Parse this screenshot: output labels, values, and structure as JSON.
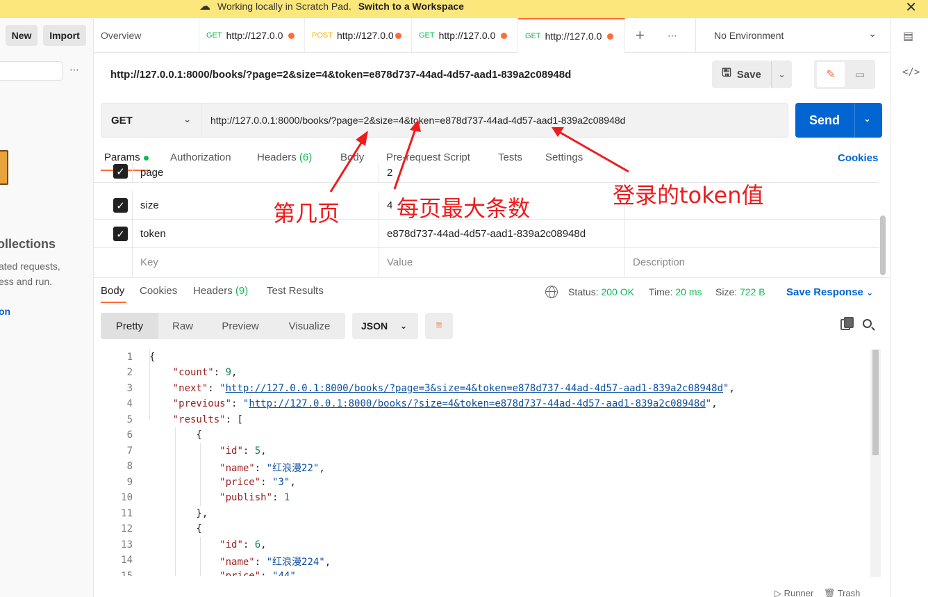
{
  "banner": {
    "message": "Working locally in Scratch Pad.",
    "link": "Switch to a Workspace"
  },
  "sidebar": {
    "new_label": "New",
    "import_label": "Import",
    "more": "⋯",
    "empty_heading": "ollections",
    "empty_text_1": "ated requests,",
    "empty_text_2": "ess and run.",
    "empty_link": "on"
  },
  "tabs": {
    "overview": "Overview",
    "items": [
      {
        "method": "GET",
        "label": "http://127.0.0"
      },
      {
        "method": "POST",
        "label": "http://127.0.0"
      },
      {
        "method": "GET",
        "label": "http://127.0.0"
      },
      {
        "method": "GET",
        "label": "http://127.0.0"
      }
    ],
    "plus": "+",
    "more": "⋯",
    "environment": "No Environment"
  },
  "request": {
    "title": "http://127.0.0.1:8000/books/?page=2&size=4&token=e878d737-44ad-4d57-aad1-839a2c08948d",
    "save_label": "Save",
    "method": "GET",
    "url": "http://127.0.0.1:8000/books/?page=2&size=4&token=e878d737-44ad-4d57-aad1-839a2c08948d",
    "send_label": "Send"
  },
  "request_tabs": {
    "params": "Params",
    "authorization": "Authorization",
    "headers": "Headers",
    "headers_count": "(6)",
    "body": "Body",
    "prerequest": "Pre-request Script",
    "tests": "Tests",
    "settings": "Settings",
    "cookies": "Cookies"
  },
  "params": {
    "rows": [
      {
        "key": "page",
        "value": "2"
      },
      {
        "key": "size",
        "value": "4"
      },
      {
        "key": "token",
        "value": "e878d737-44ad-4d57-aad1-839a2c08948d"
      }
    ],
    "key_placeholder": "Key",
    "value_placeholder": "Value",
    "description_placeholder": "Description"
  },
  "response": {
    "tabs": {
      "body": "Body",
      "cookies": "Cookies",
      "headers": "Headers",
      "headers_count": "(9)",
      "test_results": "Test Results"
    },
    "status_label": "Status:",
    "status_value": "200 OK",
    "time_label": "Time:",
    "time_value": "20 ms",
    "size_label": "Size:",
    "size_value": "722 B",
    "save_response": "Save Response",
    "formats": [
      "Pretty",
      "Raw",
      "Preview",
      "Visualize"
    ],
    "language": "JSON"
  },
  "code": {
    "line_numbers": [
      "1",
      "2",
      "3",
      "4",
      "5",
      "6",
      "7",
      "8",
      "9",
      "10",
      "11",
      "12",
      "13",
      "14",
      "15"
    ],
    "count_key": "\"count\"",
    "count_val": "9",
    "next_key": "\"next\"",
    "next_val": "http://127.0.0.1:8000/books/?page=3&size=4&token=e878d737-44ad-4d57-aad1-839a2c08948d",
    "prev_key": "\"previous\"",
    "prev_val": "http://127.0.0.1:8000/books/?size=4&token=e878d737-44ad-4d57-aad1-839a2c08948d",
    "results_key": "\"results\"",
    "id_key": "\"id\"",
    "name_key": "\"name\"",
    "price_key": "\"price\"",
    "publish_key": "\"publish\"",
    "item1": {
      "id": "5",
      "name": "\"红浪漫22\"",
      "price": "\"3\"",
      "publish": "1"
    },
    "item2": {
      "id": "6",
      "name": "\"红浪漫224\"",
      "price": "\"44\""
    }
  },
  "annotations": {
    "page_note": "第几页",
    "size_note": "每页最大条数",
    "token_note": "登录的token值"
  },
  "footer": {
    "runner": "Runner",
    "trash": "Trash"
  },
  "colors": {
    "accent": "#ff6c37",
    "primary": "#0265d2",
    "get": "#0cbb52",
    "post": "#ffb400",
    "annotation": "#ee1c1c"
  }
}
